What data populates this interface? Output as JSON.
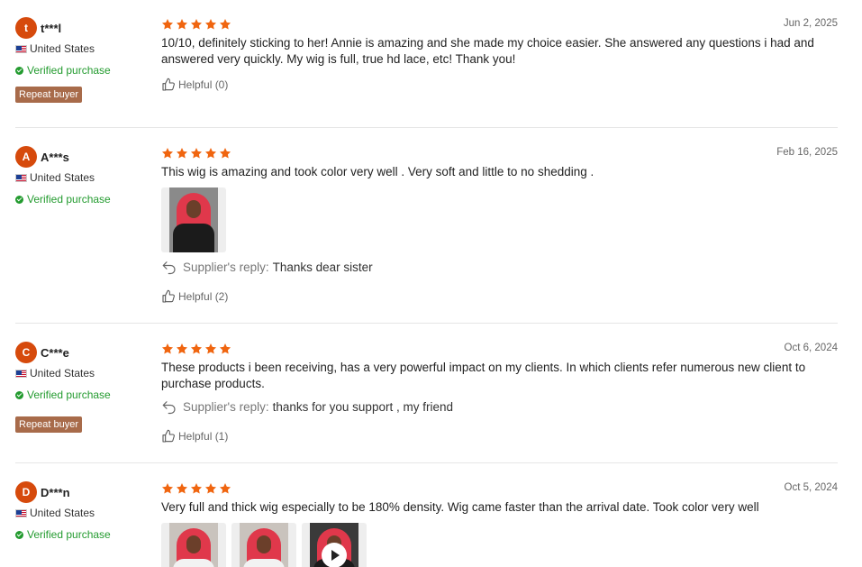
{
  "reviews": [
    {
      "avatar_letter": "t",
      "username": "t***l",
      "country": "United States",
      "verified": "Verified purchase",
      "repeat_buyer": "Repeat buyer",
      "rating": 5,
      "date": "Jun 2, 2025",
      "text": "10/10, definitely sticking to her! Annie is amazing and she made my choice easier. She answered any questions i had and answered very quickly. My wig is full, true hd lace, etc! Thank you!",
      "helpful": "Helpful (0)"
    },
    {
      "avatar_letter": "A",
      "username": "A***s",
      "country": "United States",
      "verified": "Verified purchase",
      "rating": 5,
      "date": "Feb 16, 2025",
      "text": "This wig is amazing and took color very well . Very soft and little to no shedding .",
      "photos": 1,
      "reply_label": "Supplier's reply:",
      "reply_text": "Thanks dear sister",
      "helpful": "Helpful (2)"
    },
    {
      "avatar_letter": "C",
      "username": "C***e",
      "country": "United States",
      "verified": "Verified purchase",
      "repeat_buyer": "Repeat buyer",
      "rating": 5,
      "date": "Oct 6, 2024",
      "text": "These products i been receiving, has a very powerful impact on my clients. In which clients refer numerous new client to purchase products.",
      "reply_label": "Supplier's reply:",
      "reply_text": "thanks for you support , my friend",
      "helpful": "Helpful (1)"
    },
    {
      "avatar_letter": "D",
      "username": "D***n",
      "country": "United States",
      "verified": "Verified purchase",
      "rating": 5,
      "date": "Oct 5, 2024",
      "text": "Very full and thick wig especially to be 180% density. Wig came faster than the arrival date. Took color very well",
      "photos": 2,
      "videos": 1
    }
  ],
  "colors": {
    "star": "#f0650f",
    "avatar": "#d64a0c",
    "verified": "#239b2f",
    "repeat_badge": "#a86b4a"
  },
  "icons": [
    "star-icon",
    "flag-us-icon",
    "verified-check-icon",
    "reply-arrow-icon",
    "thumbs-up-icon",
    "play-icon"
  ]
}
